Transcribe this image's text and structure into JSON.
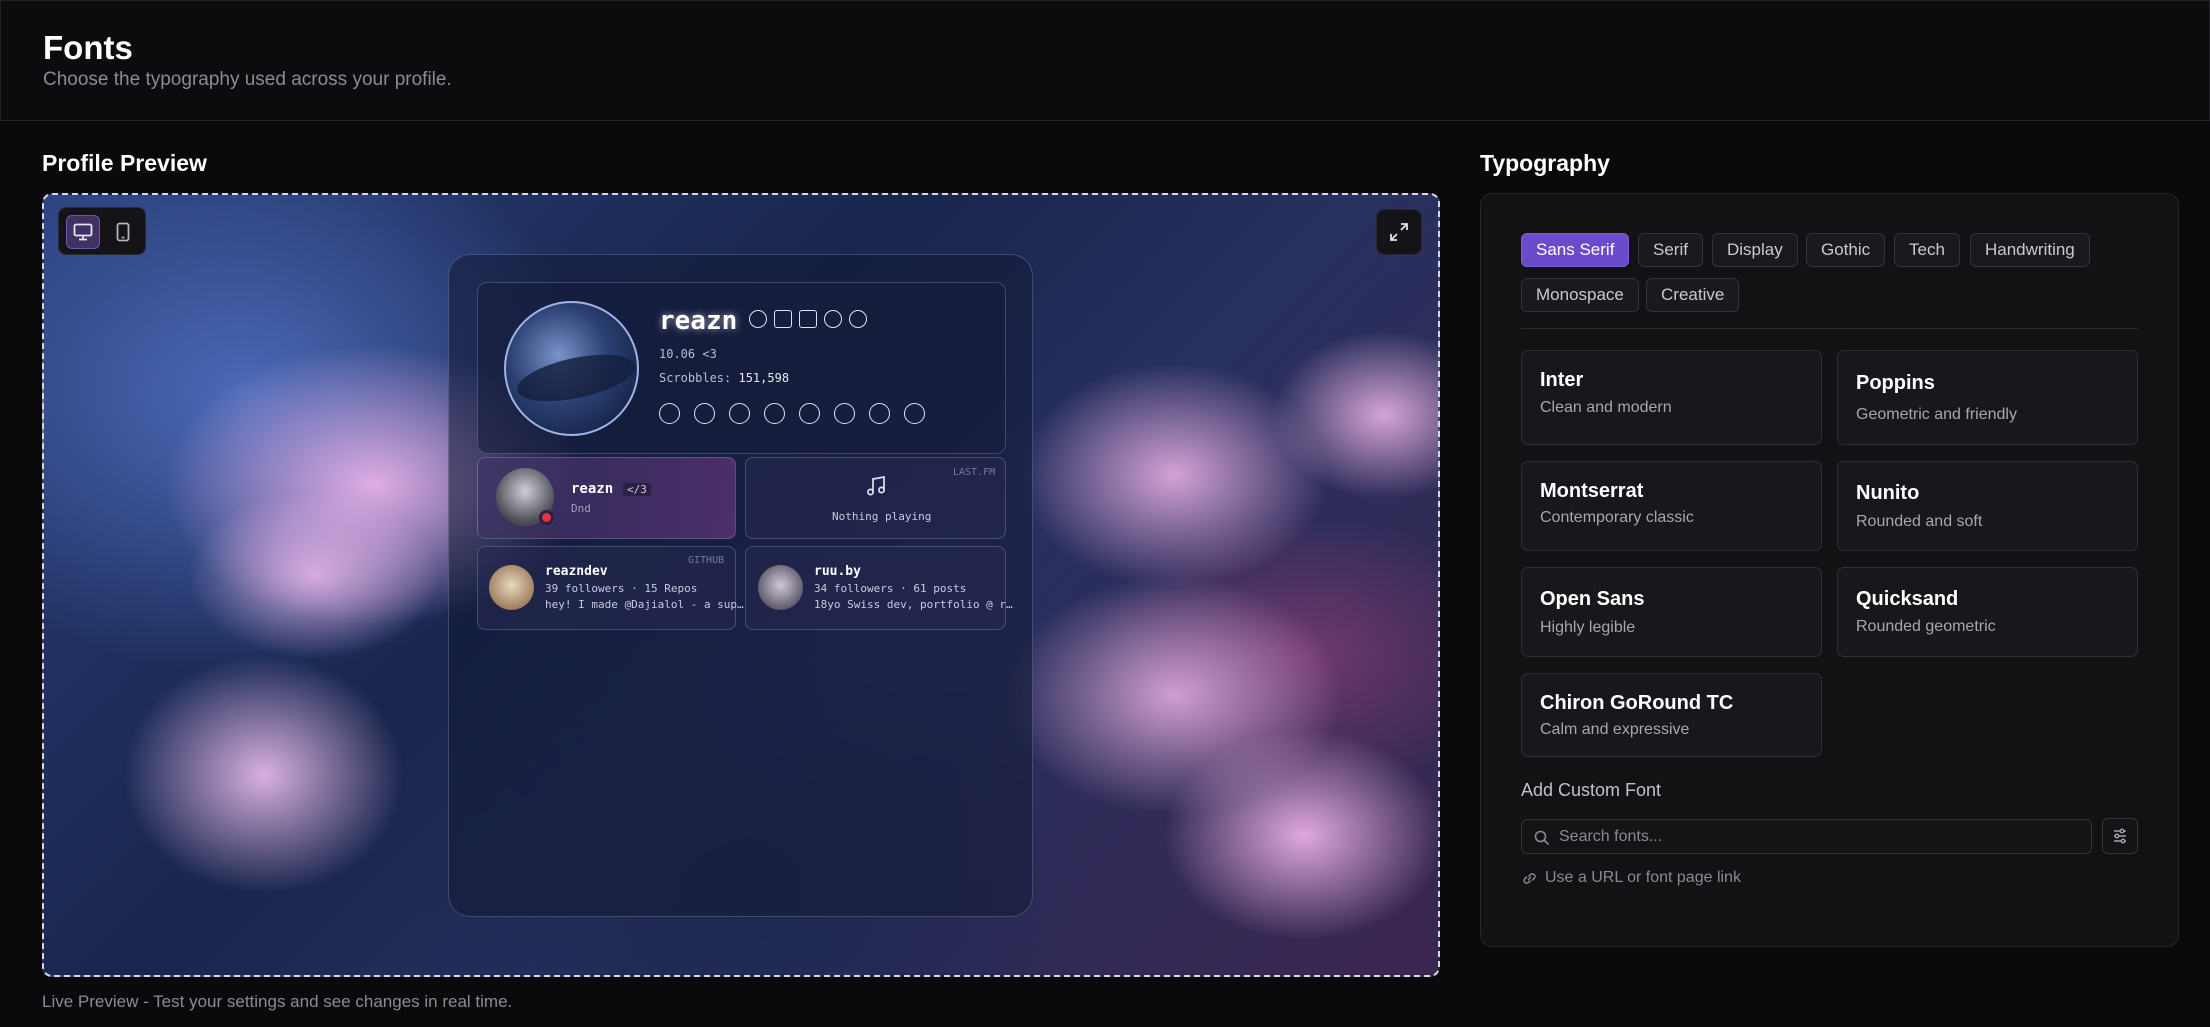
{
  "header": {
    "title": "Fonts",
    "subtitle": "Choose the typography used across your profile."
  },
  "preview": {
    "section_title": "Profile Preview",
    "caption": "Live Preview - Test your settings and see changes in real time.",
    "device_modes": [
      "desktop",
      "mobile"
    ],
    "active_device": "desktop",
    "profile": {
      "username": "reazn",
      "tagline": "10.06 <3",
      "scrobbles_label": "Scrobbles:",
      "scrobbles_value": "151,598",
      "badge_icons": [
        "verified-icon",
        "crown-icon",
        "calendar-icon",
        "users-icon",
        "tools-icon"
      ],
      "social_icons": [
        "osu-icon",
        "bluesky-icon",
        "github-icon",
        "discord-icon",
        "lastfm-icon",
        "spotify-icon",
        "reddit-icon",
        "globe-icon"
      ]
    },
    "discord_card": {
      "username": "reazn",
      "tag": "</3",
      "status": "Dnd"
    },
    "lastfm_card": {
      "tag": "LAST.FM",
      "status": "Nothing playing"
    },
    "github_card": {
      "tag": "GITHUB",
      "username": "reazndev",
      "stats": "39 followers · 15 Repos",
      "bio": "hey! I made @Dajialol - a sup…"
    },
    "bluesky_card": {
      "username": "ruu.by",
      "stats": "34 followers · 61 posts",
      "bio": "18yo Swiss dev, portfolio @ r…"
    }
  },
  "typography": {
    "section_title": "Typography",
    "categories": [
      "Sans Serif",
      "Serif",
      "Display",
      "Gothic",
      "Tech",
      "Handwriting",
      "Monospace",
      "Creative"
    ],
    "active_category": "Sans Serif",
    "fonts": [
      {
        "name": "Inter",
        "description": "Clean and modern"
      },
      {
        "name": "Poppins",
        "description": "Geometric and friendly"
      },
      {
        "name": "Montserrat",
        "description": "Contemporary classic"
      },
      {
        "name": "Nunito",
        "description": "Rounded and soft"
      },
      {
        "name": "Open Sans",
        "description": "Highly legible"
      },
      {
        "name": "Quicksand",
        "description": "Rounded geometric"
      },
      {
        "name": "Chiron GoRound TC",
        "description": "Calm and expressive"
      }
    ],
    "custom_font": {
      "label": "Add Custom Font",
      "search_placeholder": "Search fonts...",
      "url_hint": "Use a URL or font page link"
    }
  },
  "colors": {
    "accent": "#6a4bc9",
    "background": "#0a0a0c",
    "panel": "#121215"
  }
}
